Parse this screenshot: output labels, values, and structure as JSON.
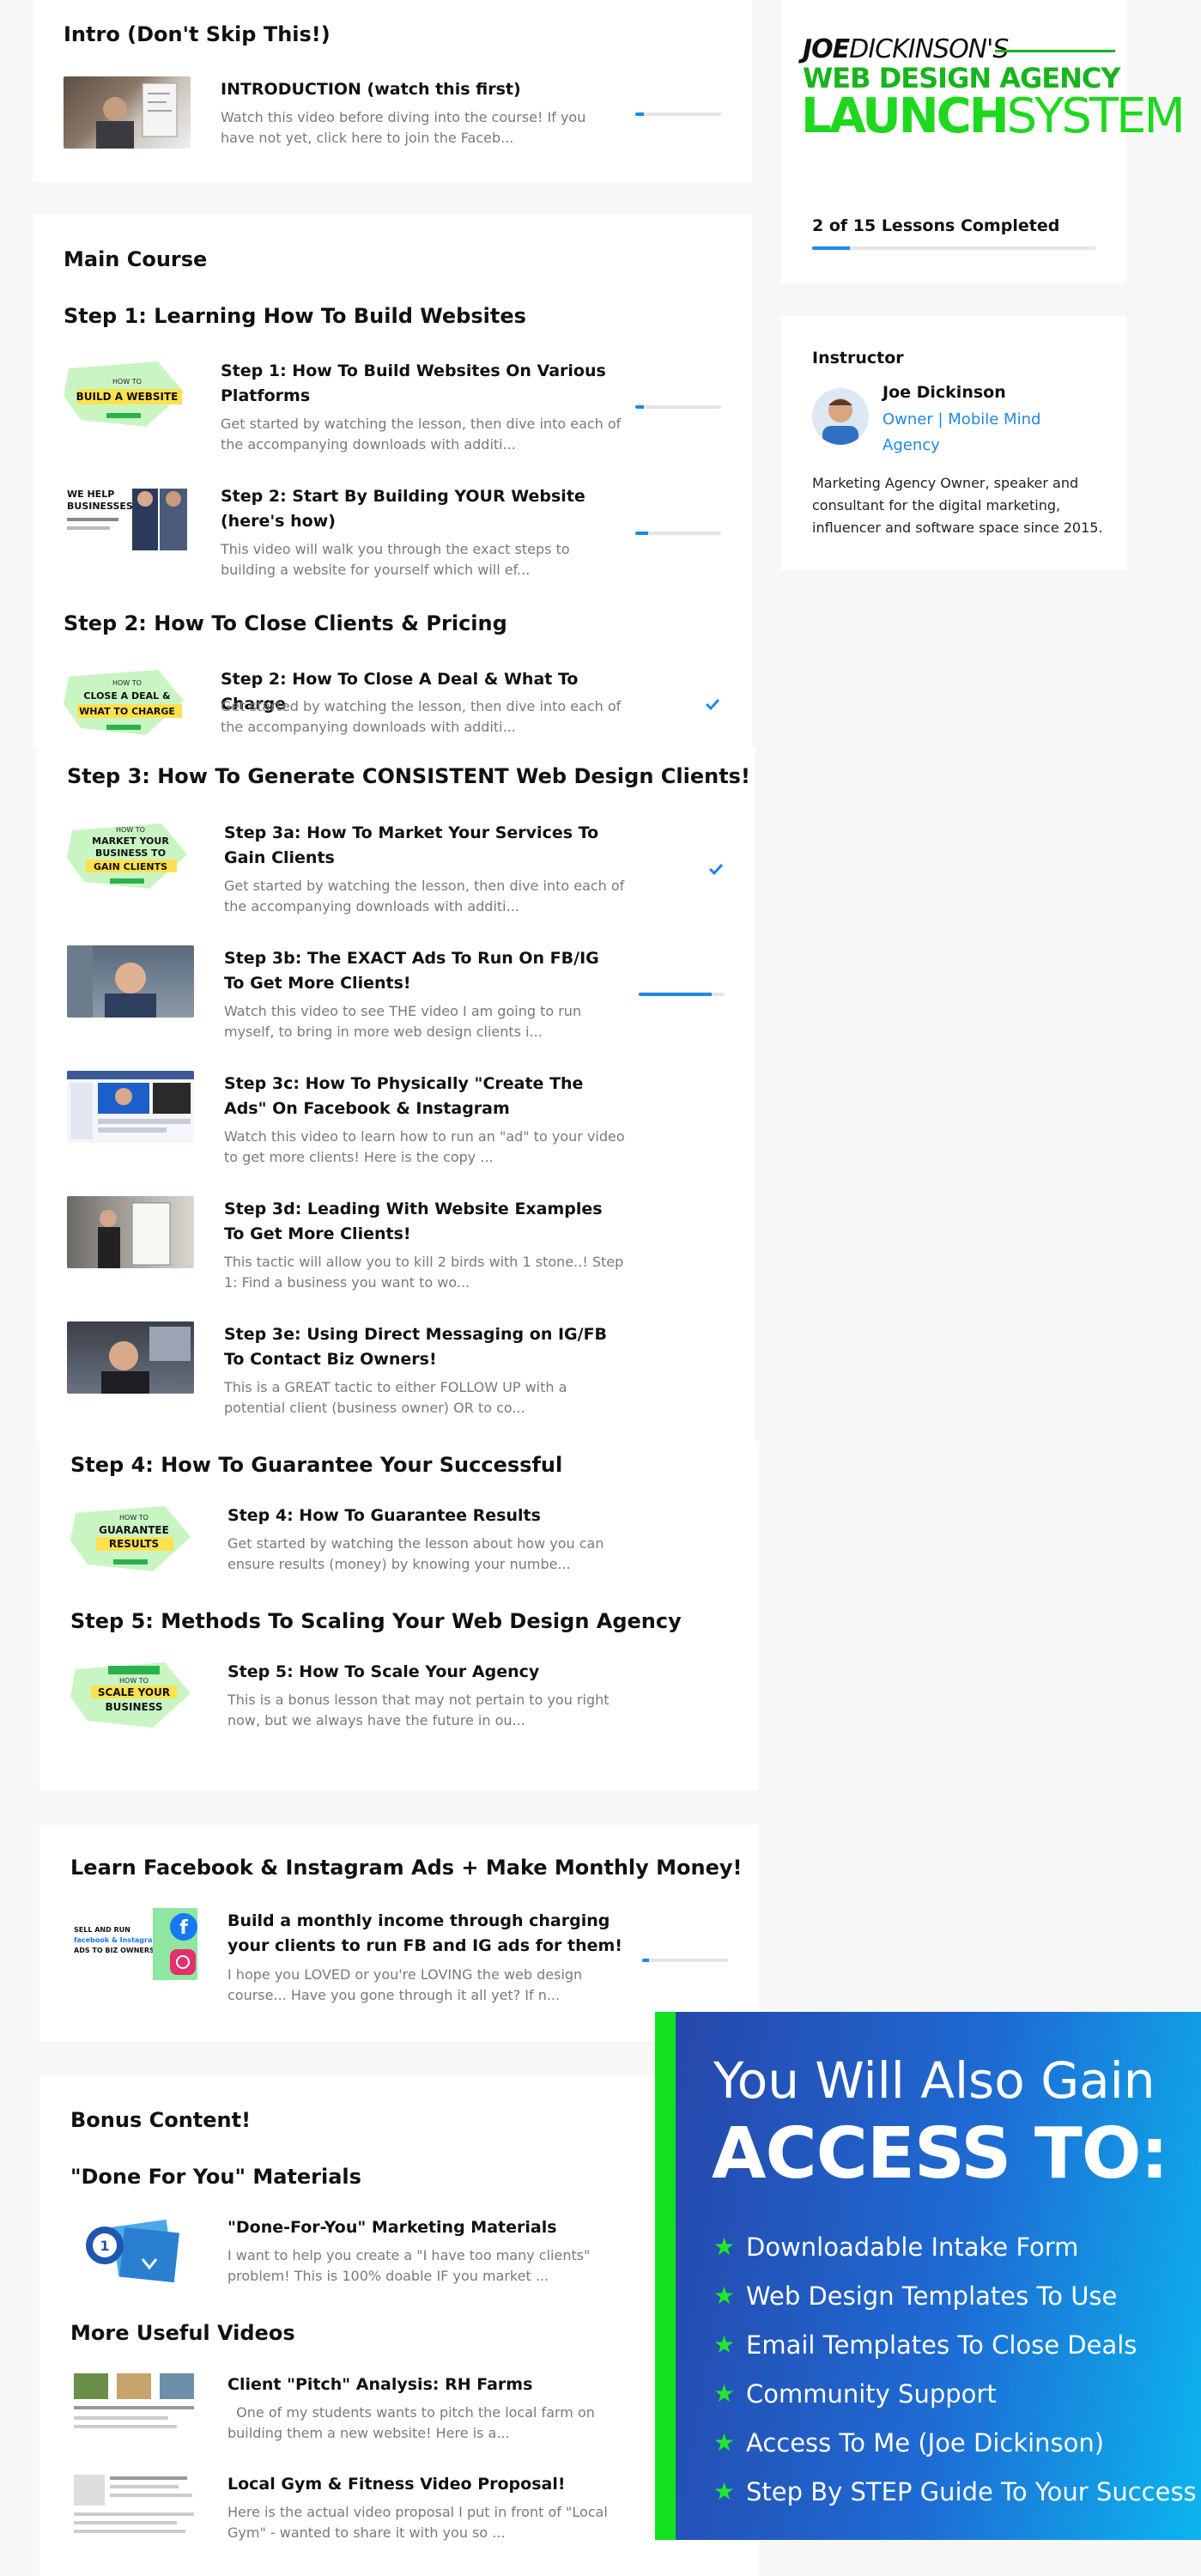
{
  "intro": {
    "heading": "Intro (Don't Skip This!)",
    "lessons": [
      {
        "title": "INTRODUCTION (watch this first)",
        "desc": "Watch this video before diving into the course! If you have not yet, click here to join the Faceb...",
        "progress": 0.1,
        "completed": false
      }
    ]
  },
  "main": {
    "heading": "Main Course",
    "steps": [
      {
        "heading": "Step 1: Learning How To Build Websites",
        "lessons": [
          {
            "title": "Step 1: How To Build Websites On Various Platforms",
            "desc": "Get started by watching the lesson, then dive into each of the accompanying downloads with additi...",
            "thumb": "HOW TO BUILD A WEBSITE",
            "progress": 0.1,
            "completed": false
          },
          {
            "title": "Step 2: Start By Building YOUR Website (here's how)",
            "desc": "This video will walk you through the exact steps to building a website for yourself which will ef...",
            "thumb": "WE HELP BUSINESSES",
            "progress": 0.15,
            "completed": false
          }
        ]
      },
      {
        "heading": "Step 2: How To Close Clients & Pricing",
        "lessons": [
          {
            "title": "Step 2: How To Close A Deal & What To Charge",
            "desc": "Get started by watching the lesson, then dive into each of the accompanying downloads with additi...",
            "thumb": "CLOSE A DEAL & WHAT TO CHARGE",
            "completed": true
          }
        ]
      },
      {
        "heading": "Step 3: How To Generate CONSISTENT Web Design Clients!",
        "lessons": [
          {
            "title": "Step 3a: How To Market Your Services To Gain Clients",
            "desc": "Get started by watching the lesson, then dive into each of the accompanying downloads with additi...",
            "thumb": "MARKET YOUR BUSINESS TO GAIN CLIENTS",
            "completed": true
          },
          {
            "title": "Step 3b: The EXACT Ads To Run On FB/IG To Get More Clients!",
            "desc": "Watch this video to see THE video I am going to run myself, to bring in more web design clients i...",
            "progress": 0.85,
            "completed": false
          },
          {
            "title": "Step 3c: How To Physically \"Create The Ads\" On Facebook & Instagram",
            "desc": "Watch this video to learn how to run an \"ad\" to your video to get more clients! Here is the copy ...",
            "completed": false
          },
          {
            "title": "Step 3d: Leading With Website Examples To Get More Clients!",
            "desc": "This tactic will allow you to kill 2 birds with 1 stone..! Step 1: Find a business you want to wo...",
            "completed": false
          },
          {
            "title": "Step 3e: Using Direct Messaging on IG/FB To Contact Biz Owners!",
            "desc": "This is a GREAT tactic to either FOLLOW UP with a potential client (business owner) OR to co...",
            "completed": false
          }
        ]
      },
      {
        "heading": "Step 4: How To Guarantee Your Successful",
        "lessons": [
          {
            "title": "Step 4: How To Guarantee Results",
            "desc": "Get started by watching the lesson about how you can ensure results (money) by knowing your numbe...",
            "thumb": "GUARANTEE RESULTS",
            "completed": false
          }
        ]
      },
      {
        "heading": "Step 5: Methods To Scaling Your Web Design Agency",
        "lessons": [
          {
            "title": "Step 5: How To Scale Your Agency",
            "desc": "This is a bonus lesson that may not pertain to you right now, but we always have the future in ou...",
            "thumb": "SCALE YOUR BUSINESS",
            "completed": false
          }
        ]
      }
    ]
  },
  "ads": {
    "heading": "Learn Facebook & Instagram Ads + Make Monthly Money!",
    "lessons": [
      {
        "title": "Build a monthly income through charging your clients to run FB and IG ads for them!",
        "desc": "I hope you LOVED or you're LOVING the web design course... Have you gone through it all yet? If n...",
        "thumb": "SELL AND RUN facebook & Instagram ADS TO BIZ OWNERS",
        "progress": 0.08,
        "completed": false
      }
    ]
  },
  "bonus": {
    "heading": "Bonus Content!",
    "sections": [
      {
        "heading": "\"Done For You\" Materials",
        "lessons": [
          {
            "title": "\"Done-For-You\" Marketing Materials",
            "desc": "I want to help you create a \"I have too many clients\" problem! This is 100% doable IF you market ..."
          }
        ]
      },
      {
        "heading": "More Useful Videos",
        "lessons": [
          {
            "title": "Client \"Pitch\" Analysis: RH Farms",
            "desc": "  One of my students wants to pitch the local farm on building them a new website! Here is a..."
          },
          {
            "title": "Local Gym & Fitness Video Proposal!",
            "desc": "Here is the actual video proposal I put in front of \"Local Gym\" - wanted to share it with you so ..."
          }
        ]
      }
    ]
  },
  "sidebar": {
    "logo": {
      "line1a": "JOE",
      "line1b": "DICKINSON'S",
      "line2": "WEB DESIGN AGENCY",
      "line3a": "LAUNCH",
      "line3b": "SYSTEM"
    },
    "progress_text": "2 of 15 Lessons Completed",
    "progress_value": 0.133,
    "instructor": {
      "label": "Instructor",
      "name": "Joe Dickinson",
      "role": "Owner | Mobile Mind Agency",
      "bio": "Marketing Agency Owner, speaker and consultant for the digital marketing, influencer and software space since 2015."
    }
  },
  "promo": {
    "line1": "You Will Also Gain",
    "line2": "ACCESS TO:",
    "items": [
      "Downloadable Intake Form",
      "Web Design Templates To Use",
      "Email Templates To Close Deals",
      "Community Support",
      "Access To Me (Joe Dickinson)",
      "Step By STEP Guide To Your Success"
    ]
  },
  "colors": {
    "accent": "#1e88e5",
    "brand_green": "#17b51c",
    "check": "#1e88e5",
    "promo_star": "#22e82a"
  }
}
